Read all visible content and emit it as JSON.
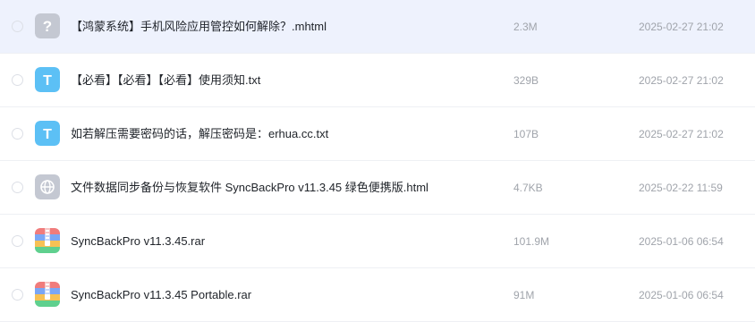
{
  "colors": {
    "selected_row_bg": "#eef2fd",
    "text_icon_bg": "#5cc0f5",
    "unknown_icon_bg": "#c4c8d2",
    "web_icon_bg": "#c4c8d2",
    "meta_text": "#a0a4ab"
  },
  "files": [
    {
      "name": "【鸿蒙系统】手机风险应用管控如何解除？.mhtml",
      "size": "2.3M",
      "date": "2025-02-27 21:02",
      "icon": "unknown-file-icon",
      "icon_glyph": "?",
      "selected": true
    },
    {
      "name": "【必看】【必看】【必看】使用须知.txt",
      "size": "329B",
      "date": "2025-02-27 21:02",
      "icon": "text-file-icon",
      "icon_glyph": "T",
      "selected": false
    },
    {
      "name": "如若解压需要密码的话，解压密码是：erhua.cc.txt",
      "size": "107B",
      "date": "2025-02-27 21:02",
      "icon": "text-file-icon",
      "icon_glyph": "T",
      "selected": false
    },
    {
      "name": "文件数据同步备份与恢复软件 SyncBackPro v11.3.45 绿色便携版.html",
      "size": "4.7KB",
      "date": "2025-02-22 11:59",
      "icon": "web-file-icon",
      "icon_glyph": "",
      "selected": false
    },
    {
      "name": "SyncBackPro v11.3.45.rar",
      "size": "101.9M",
      "date": "2025-01-06 06:54",
      "icon": "archive-file-icon",
      "icon_glyph": "",
      "selected": false
    },
    {
      "name": "SyncBackPro v11.3.45 Portable.rar",
      "size": "91M",
      "date": "2025-01-06 06:54",
      "icon": "archive-file-icon",
      "icon_glyph": "",
      "selected": false
    }
  ]
}
